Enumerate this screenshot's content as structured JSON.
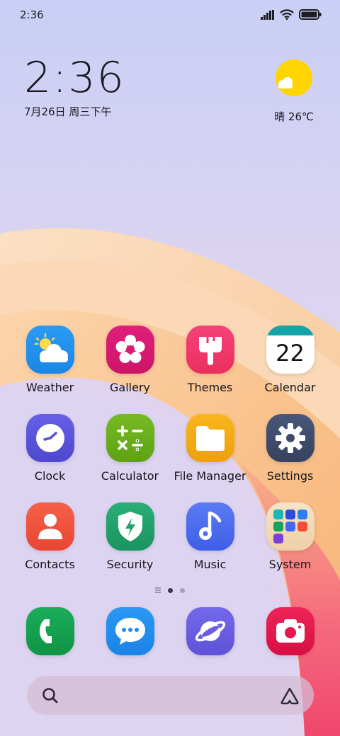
{
  "status_bar": {
    "time": "2:36"
  },
  "clock_widget": {
    "time": "2:36",
    "date": "7月26日 周三下午"
  },
  "weather_widget": {
    "temp": "晴 26℃",
    "icon": "sun-cloud-icon"
  },
  "apps": [
    {
      "label": "Weather",
      "icon": "weather-icon",
      "color": "#1f8ff0"
    },
    {
      "label": "Gallery",
      "icon": "flower-icon",
      "color": "#d81b74"
    },
    {
      "label": "Themes",
      "icon": "brush-icon",
      "color": "#f0386b"
    },
    {
      "label": "Calendar",
      "icon": "calendar-icon",
      "color": "#14a4a8",
      "day": "22"
    },
    {
      "label": "Clock",
      "icon": "clock-icon",
      "color": "#5b54d8"
    },
    {
      "label": "Calculator",
      "icon": "calculator-icon",
      "color": "#6aae1e"
    },
    {
      "label": "File Manager",
      "icon": "folder-icon",
      "color": "#f3a813"
    },
    {
      "label": "Settings",
      "icon": "gear-icon",
      "color": "#3f4c69"
    },
    {
      "label": "Contacts",
      "icon": "person-icon",
      "color": "#f0553e"
    },
    {
      "label": "Security",
      "icon": "shield-bolt-icon",
      "color": "#21a06b"
    },
    {
      "label": "Music",
      "icon": "music-note-icon",
      "color": "#4d6cf0"
    },
    {
      "label": "System",
      "icon": "folder-grid-icon",
      "color": "#f3d9b3"
    }
  ],
  "dock": [
    {
      "icon": "phone-icon",
      "color": "#14a050"
    },
    {
      "icon": "message-icon",
      "color": "#1f8ff0"
    },
    {
      "icon": "browser-icon",
      "color": "#6a5fe0"
    },
    {
      "icon": "camera-icon",
      "color": "#e6174e"
    }
  ]
}
